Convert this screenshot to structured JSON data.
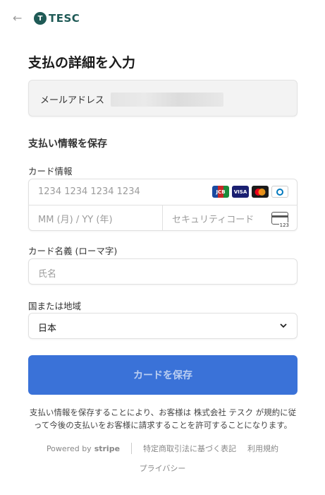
{
  "header": {
    "back_icon": "arrow-left-icon",
    "logo_mark": "T",
    "logo_text": "TESC"
  },
  "title": "支払の詳細を入力",
  "email": {
    "label": "メールアドレス",
    "value_hidden": true
  },
  "section_title": "支払い情報を保存",
  "card": {
    "label": "カード情報",
    "number_placeholder": "1234 1234 1234 1234",
    "expiry_placeholder": "MM (月) / YY (年)",
    "cvc_placeholder": "セキュリティコード",
    "brands": [
      "JCB",
      "VISA",
      "Mastercard",
      "Diners"
    ],
    "cvc_icon_text": "123"
  },
  "cardholder": {
    "label": "カード名義 (ローマ字)",
    "placeholder": "氏名"
  },
  "country": {
    "label": "国または地域",
    "value": "日本"
  },
  "save_button": "カードを保存",
  "terms": "支払い情報を保存することにより、お客様は 株式会社 テスク が規約に従って今後の支払いをお客様に請求することを許可することになります。",
  "footer": {
    "powered_by": "Powered by",
    "stripe": "stripe",
    "links": [
      "特定商取引法に基づく表記",
      "利用規約",
      "プライバシー"
    ]
  },
  "colors": {
    "accent": "#3a72d8",
    "logo": "#1f5a56"
  }
}
